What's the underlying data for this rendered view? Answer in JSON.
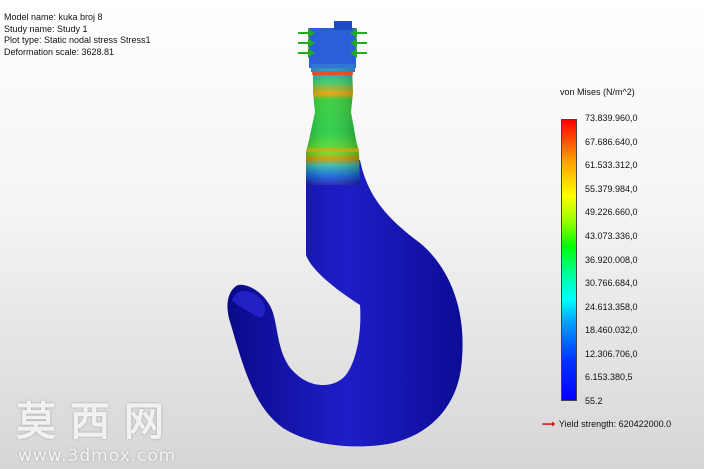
{
  "info": {
    "model_name": "Model name: kuka broj 8",
    "study_name": "Study name: Study 1",
    "plot_type": "Plot type: Static nodal stress Stress1",
    "deformation_scale": "Deformation scale: 3628.81"
  },
  "legend": {
    "title": "von Mises (N/m^2)",
    "labels": [
      "73.839.960,0",
      "67.686.640,0",
      "61.533.312,0",
      "55.379.984,0",
      "49.226.660,0",
      "43.073.336,0",
      "36.920.008,0",
      "30.766.684,0",
      "24.613.358,0",
      "18.460.032,0",
      "12.306.706,0",
      "6.153.380,5",
      "55.2"
    ],
    "colors": [
      "#ff0000",
      "#ff9900",
      "#ffff00",
      "#00ff00",
      "#00ffff",
      "#0000ff"
    ]
  },
  "yield": {
    "arrow_icon": "arrow-right-icon",
    "label": "Yield strength: 620422000.0",
    "color": "#cc0000"
  },
  "watermark": {
    "chinese": "莫西网",
    "url": "www.3dmox.com"
  }
}
